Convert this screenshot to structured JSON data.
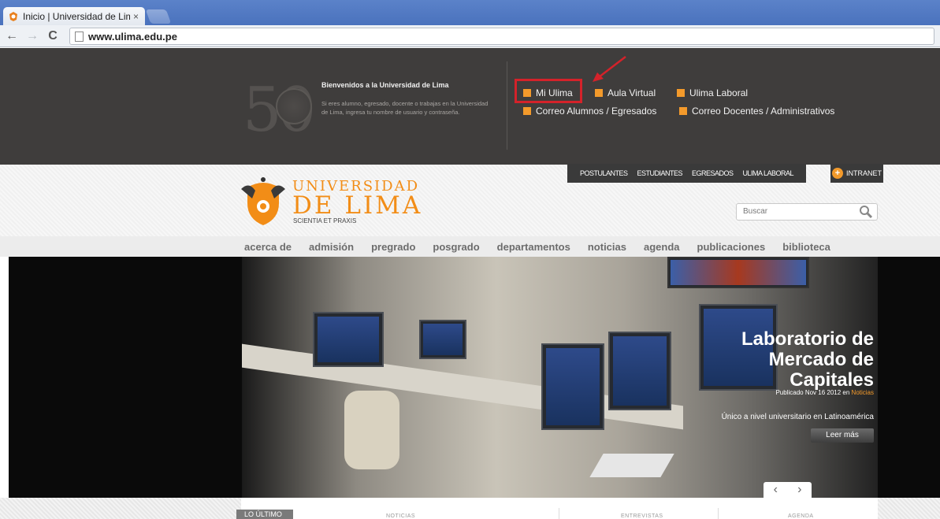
{
  "browser": {
    "tab_title": "Inicio | Universidad de Lim",
    "tab_close": "×",
    "url": "www.ulima.edu.pe",
    "back": "←",
    "forward": "→",
    "reload": "C"
  },
  "top_bar": {
    "anniversary": "50",
    "welcome_title": "Bienvenidos a la Universidad de Lima",
    "welcome_text": "Si eres alumno, egresado, docente o trabajas en la Universidad de Lima, ingresa tu nombre de usuario y contraseña.",
    "quick_links": [
      "Mi Ulima",
      "Aula Virtual",
      "Ulima Laboral",
      "Correo Alumnos / Egresados",
      "Correo Docentes / Administrativos"
    ],
    "accent_color": "#f39a2b",
    "highlight_color": "#d4222a"
  },
  "header": {
    "logo_line1": "UNIVERSIDAD",
    "logo_line2": "DE LIMA",
    "logo_tagline": "SCIENTIA ET PRAXIS",
    "secondary_nav": [
      "POSTULANTES",
      "ESTUDIANTES",
      "EGRESADOS",
      "ULIMA LABORAL"
    ],
    "intranet": "INTRANET",
    "search_placeholder": "Buscar",
    "brand_color": "#f28d17"
  },
  "main_nav": [
    "acerca de",
    "admisión",
    "pregrado",
    "posgrado",
    "departamentos",
    "noticias",
    "agenda",
    "publicaciones",
    "biblioteca"
  ],
  "hero": {
    "title": "Laboratorio de Mercado de Capitales",
    "meta_prefix": "Publicado Nov 16 2012 en",
    "meta_category": "Noticias",
    "subtitle": "Único a nivel universitario en Latinoamérica",
    "read_more": "Leer más",
    "prev": "‹",
    "next": "›"
  },
  "bottom": {
    "active_tab": "LO ÚLTIMO",
    "tabs": [
      "NOTICIAS",
      "ENTREVISTAS",
      "AGENDA"
    ]
  }
}
